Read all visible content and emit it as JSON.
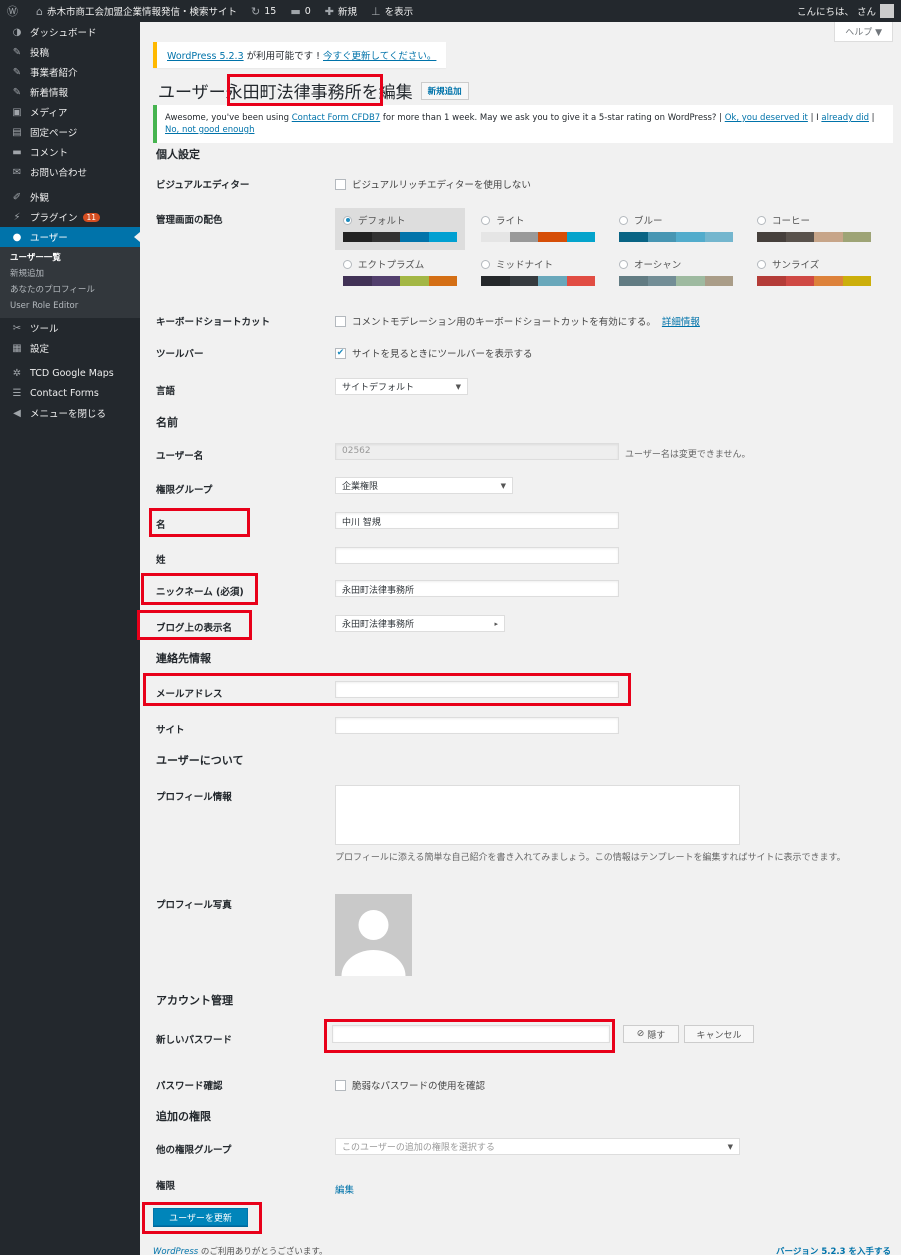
{
  "admin_bar": {
    "site_name": "赤木市商工会加盟企業情報発信・検索サイト",
    "updates_count": "15",
    "comments_count": "0",
    "new_label": "新規",
    "view_label": "を表示",
    "howdy": "こんにちは、 さん"
  },
  "sidebar": {
    "items": [
      {
        "label": "ダッシュボード",
        "icon": "dashboard-icon",
        "glyph": "◑"
      },
      {
        "label": "投稿",
        "icon": "pin-icon",
        "glyph": "✎"
      },
      {
        "label": "事業者紹介",
        "icon": "pin-icon",
        "glyph": "✎"
      },
      {
        "label": "新着情報",
        "icon": "pin-icon",
        "glyph": "✎"
      },
      {
        "label": "メディア",
        "icon": "media-icon",
        "glyph": "▣"
      },
      {
        "label": "固定ページ",
        "icon": "page-icon",
        "glyph": "▤"
      },
      {
        "label": "コメント",
        "icon": "comment-icon",
        "glyph": "▬"
      },
      {
        "label": "お問い合わせ",
        "icon": "mail-icon",
        "glyph": "✉"
      },
      {
        "label": "外観",
        "icon": "appearance-icon",
        "glyph": "✐"
      },
      {
        "label": "プラグイン",
        "icon": "plugin-icon",
        "glyph": "⚡",
        "badge": "11"
      },
      {
        "label": "ユーザー",
        "icon": "users-icon",
        "glyph": "●"
      },
      {
        "label": "ツール",
        "icon": "tools-icon",
        "glyph": "✂"
      },
      {
        "label": "設定",
        "icon": "settings-icon",
        "glyph": "▦"
      },
      {
        "label": "TCD Google Maps",
        "icon": "gear-icon",
        "glyph": "✲"
      },
      {
        "label": "Contact Forms",
        "icon": "forms-icon",
        "glyph": "☰"
      },
      {
        "label": "メニューを閉じる",
        "icon": "collapse-icon",
        "glyph": "◀"
      }
    ],
    "user_submenu": [
      "ユーザー一覧",
      "新規追加",
      "あなたのプロフィール",
      "User Role Editor"
    ]
  },
  "help_label": "ヘルプ ▼",
  "update_nag": {
    "version": "WordPress 5.2.3",
    "text": " が利用可能です ! ",
    "link": "今すぐ更新してください。"
  },
  "title": {
    "prefix": "ユーザー",
    "name": "永田町法律事務所",
    "suffix": " を編集",
    "add_new": "新規追加"
  },
  "notice": {
    "text_a": "Awesome, you've been using ",
    "link_plugin": "Contact Form CFDB7",
    "text_b": " for more than 1 week. May we ask you to give it a 5-star rating on WordPress? | ",
    "link_ok": "Ok, you deserved it",
    "sep1": " | I ",
    "link_already": "already did",
    "sep2": " | ",
    "link_no": "No, not good enough"
  },
  "personal": {
    "heading": "個人設定",
    "visual_editor_label": "ビジュアルエディター",
    "visual_editor_text": "ビジュアルリッチエディターを使用しない",
    "color_scheme_label": "管理画面の配色",
    "schemes": [
      {
        "name": "デフォルト",
        "selected": true,
        "colors": [
          "#222222",
          "#333333",
          "#0073aa",
          "#00a0d2"
        ]
      },
      {
        "name": "ライト",
        "selected": false,
        "colors": [
          "#e5e5e5",
          "#999999",
          "#d64e07",
          "#04a4cc"
        ]
      },
      {
        "name": "ブルー",
        "selected": false,
        "colors": [
          "#096484",
          "#4796b3",
          "#52accc",
          "#74b6ce"
        ]
      },
      {
        "name": "コーヒー",
        "selected": false,
        "colors": [
          "#46403c",
          "#59524c",
          "#c7a589",
          "#9ea476"
        ]
      },
      {
        "name": "エクトプラズム",
        "selected": false,
        "colors": [
          "#413256",
          "#523f6d",
          "#a3b745",
          "#d46f15"
        ]
      },
      {
        "name": "ミッドナイト",
        "selected": false,
        "colors": [
          "#25282b",
          "#363b3f",
          "#69a8bb",
          "#e14d43"
        ]
      },
      {
        "name": "オーシャン",
        "selected": false,
        "colors": [
          "#627c83",
          "#738e96",
          "#9ebaa0",
          "#aa9d88"
        ]
      },
      {
        "name": "サンライズ",
        "selected": false,
        "colors": [
          "#b43c38",
          "#cf4944",
          "#dd823b",
          "#ccaf0b"
        ]
      }
    ],
    "shortcuts_label": "キーボードショートカット",
    "shortcuts_text": "コメントモデレーション用のキーボードショートカットを有効にする。",
    "shortcuts_link": "詳細情報",
    "toolbar_label": "ツールバー",
    "toolbar_text": "サイトを見るときにツールバーを表示する",
    "language_label": "言語",
    "language_value": "サイトデフォルト"
  },
  "name_section": {
    "heading": "名前",
    "username_label": "ユーザー名",
    "username_value": "02562",
    "username_note": "ユーザー名は変更できません。",
    "role_label": "権限グループ",
    "role_value": "企業権限",
    "first_label": "名",
    "first_value": "中川 智規",
    "last_label": "姓",
    "last_value": "",
    "nickname_label": "ニックネーム (必須)",
    "nickname_value": "永田町法律事務所",
    "display_label": "ブログ上の表示名",
    "display_value": "永田町法律事務所"
  },
  "contact": {
    "heading": "連絡先情報",
    "email_label": "メールアドレス",
    "email_value": "",
    "site_label": "サイト",
    "site_value": ""
  },
  "about": {
    "heading": "ユーザーについて",
    "bio_label": "プロフィール情報",
    "bio_desc": "プロフィールに添える簡単な自己紹介を書き入れてみましょう。この情報はテンプレートを編集すればサイトに表示できます。",
    "photo_label": "プロフィール写真"
  },
  "account": {
    "heading": "アカウント管理",
    "new_password_label": "新しいパスワード",
    "hide_button": "隠す",
    "cancel_button": "キャンセル",
    "confirm_label": "パスワード確認",
    "confirm_text": "脆弱なパスワードの使用を確認"
  },
  "extra": {
    "heading": "追加の権限",
    "other_roles_label": "他の権限グループ",
    "other_roles_placeholder": "このユーザーの追加の権限を選択する",
    "perms_label": "権限",
    "perms_link": "編集"
  },
  "submit_label": "ユーザーを更新",
  "footer": {
    "wp": "WordPress",
    "thanks": " のご利用ありがとうございます。",
    "version": "バージョン 5.2.3 を入手する"
  }
}
